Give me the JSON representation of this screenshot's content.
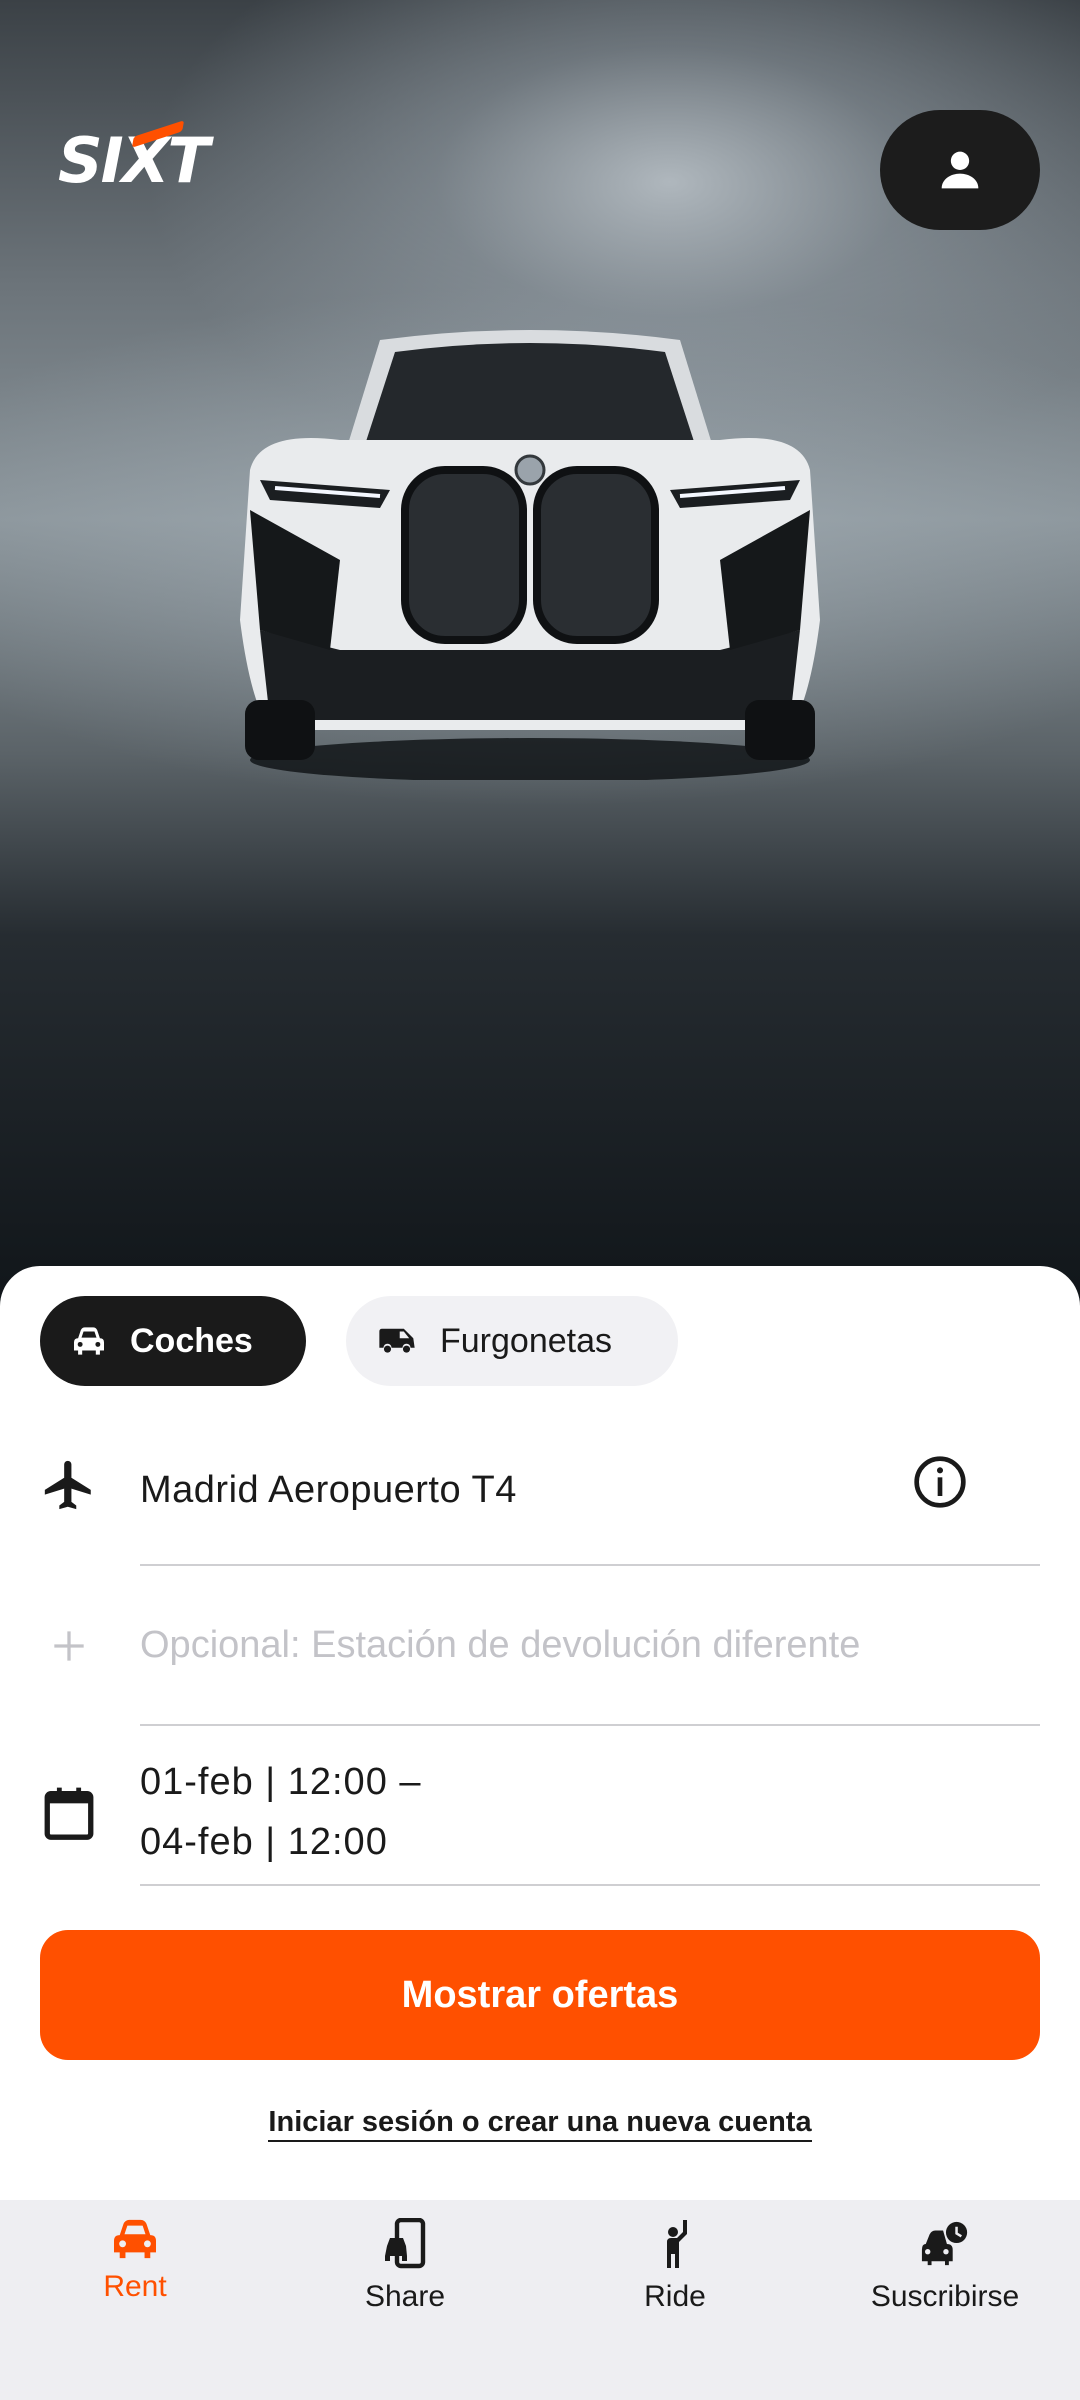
{
  "brand": {
    "logo_text": "SIXT",
    "accent": "#ff5000"
  },
  "header": {
    "profile_icon": "person-icon"
  },
  "tabs": [
    {
      "label": "Coches",
      "icon": "car-icon",
      "active": true
    },
    {
      "label": "Furgonetas",
      "icon": "van-icon",
      "active": false
    }
  ],
  "pickup": {
    "icon": "airplane-icon",
    "value": "Madrid Aeropuerto T4",
    "info_icon": "info-icon"
  },
  "return_station": {
    "icon": "plus-icon",
    "placeholder": "Opcional: Estación de devolución diferente"
  },
  "dates": {
    "icon": "calendar-icon",
    "line1": "01-feb | 12:00 –",
    "line2": "04-feb | 12:00"
  },
  "cta": {
    "label": "Mostrar ofertas"
  },
  "login": {
    "label": "Iniciar sesión o crear una nueva cuenta"
  },
  "nav": [
    {
      "label": "Rent",
      "icon": "car-icon",
      "active": true
    },
    {
      "label": "Share",
      "icon": "phone-car-icon",
      "active": false
    },
    {
      "label": "Ride",
      "icon": "person-hail-icon",
      "active": false
    },
    {
      "label": "Suscribirse",
      "icon": "car-clock-icon",
      "active": false
    }
  ]
}
